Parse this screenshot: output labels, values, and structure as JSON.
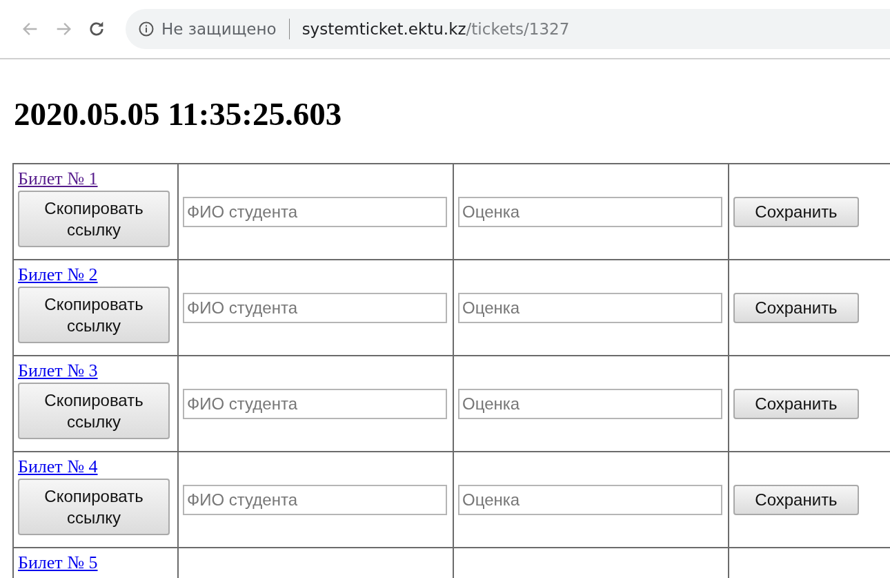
{
  "browser": {
    "security_label": "Не защищено",
    "url_host": "systemticket.ektu.kz",
    "url_path": "/tickets/1327"
  },
  "heading": "2020.05.05 11:35:25.603",
  "tickets": [
    {
      "link": "Билет № 1",
      "visited": true,
      "copy_button": "Скопировать ссылку",
      "name_placeholder": "ФИО студента",
      "grade_placeholder": "Оценка",
      "save_button": "Сохранить"
    },
    {
      "link": "Билет № 2",
      "visited": false,
      "copy_button": "Скопировать ссылку",
      "name_placeholder": "ФИО студента",
      "grade_placeholder": "Оценка",
      "save_button": "Сохранить"
    },
    {
      "link": "Билет № 3",
      "visited": false,
      "copy_button": "Скопировать ссылку",
      "name_placeholder": "ФИО студента",
      "grade_placeholder": "Оценка",
      "save_button": "Сохранить"
    },
    {
      "link": "Билет № 4",
      "visited": false,
      "copy_button": "Скопировать ссылку",
      "name_placeholder": "ФИО студента",
      "grade_placeholder": "Оценка",
      "save_button": "Сохранить"
    },
    {
      "link": "Билет № 5",
      "visited": false
    }
  ]
}
